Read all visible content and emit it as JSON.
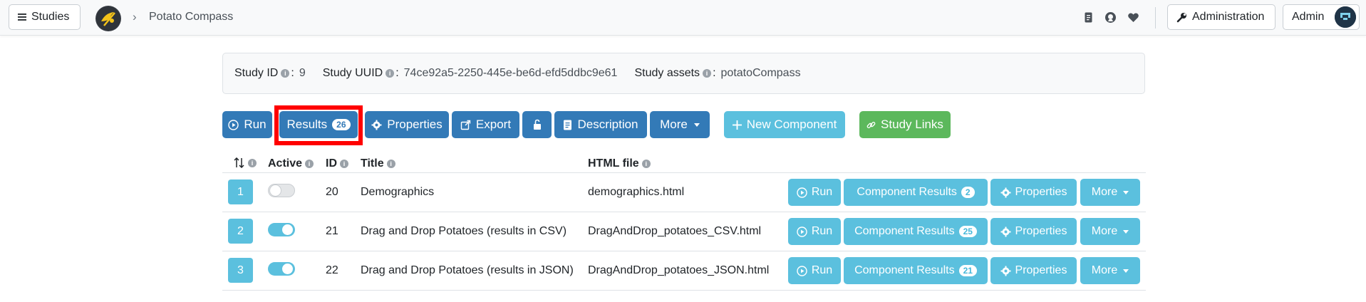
{
  "navbar": {
    "studies_label": "Studies",
    "breadcrumb": "Potato Compass",
    "admin_label": "Administration",
    "user_label": "Admin"
  },
  "study_info": {
    "id_label": "Study ID",
    "id_value": "9",
    "uuid_label": "Study UUID",
    "uuid_value": "74ce92a5-2250-445e-be6d-efd5ddbc9e61",
    "assets_label": "Study assets",
    "assets_value": "potatoCompass",
    "colon": ":"
  },
  "toolbar": {
    "run": "Run",
    "results": "Results",
    "results_count": "26",
    "properties": "Properties",
    "export": "Export",
    "description": "Description",
    "more": "More",
    "new_component": "New Component",
    "study_links": "Study Links"
  },
  "table": {
    "headers": {
      "position": "",
      "active": "Active",
      "id": "ID",
      "title": "Title",
      "html_file": "HTML file"
    },
    "rows": [
      {
        "position": "1",
        "active": false,
        "id": "20",
        "title": "Demographics",
        "html_file": "demographics.html",
        "results_count": "2"
      },
      {
        "position": "2",
        "active": true,
        "id": "21",
        "title": "Drag and Drop Potatoes (results in CSV)",
        "html_file": "DragAndDrop_potatoes_CSV.html",
        "results_count": "25"
      },
      {
        "position": "3",
        "active": true,
        "id": "22",
        "title": "Drag and Drop Potatoes (results in JSON)",
        "html_file": "DragAndDrop_potatoes_JSON.html",
        "results_count": "21"
      }
    ],
    "actions": {
      "run": "Run",
      "component_results": "Component Results",
      "properties": "Properties",
      "more": "More"
    }
  },
  "colors": {
    "primary": "#337ab7",
    "info": "#5bc0de",
    "success": "#5cb85c",
    "highlight": "#ff0000"
  },
  "icons": {
    "studies": "hamburger-icon",
    "run": "play-circle-icon",
    "properties": "gear-icon",
    "export": "external-link-icon",
    "lock": "unlock-icon",
    "description": "document-icon",
    "new_component": "plus-icon",
    "study_links": "link-icon",
    "sort": "sort-arrows-icon",
    "info": "info-icon"
  }
}
